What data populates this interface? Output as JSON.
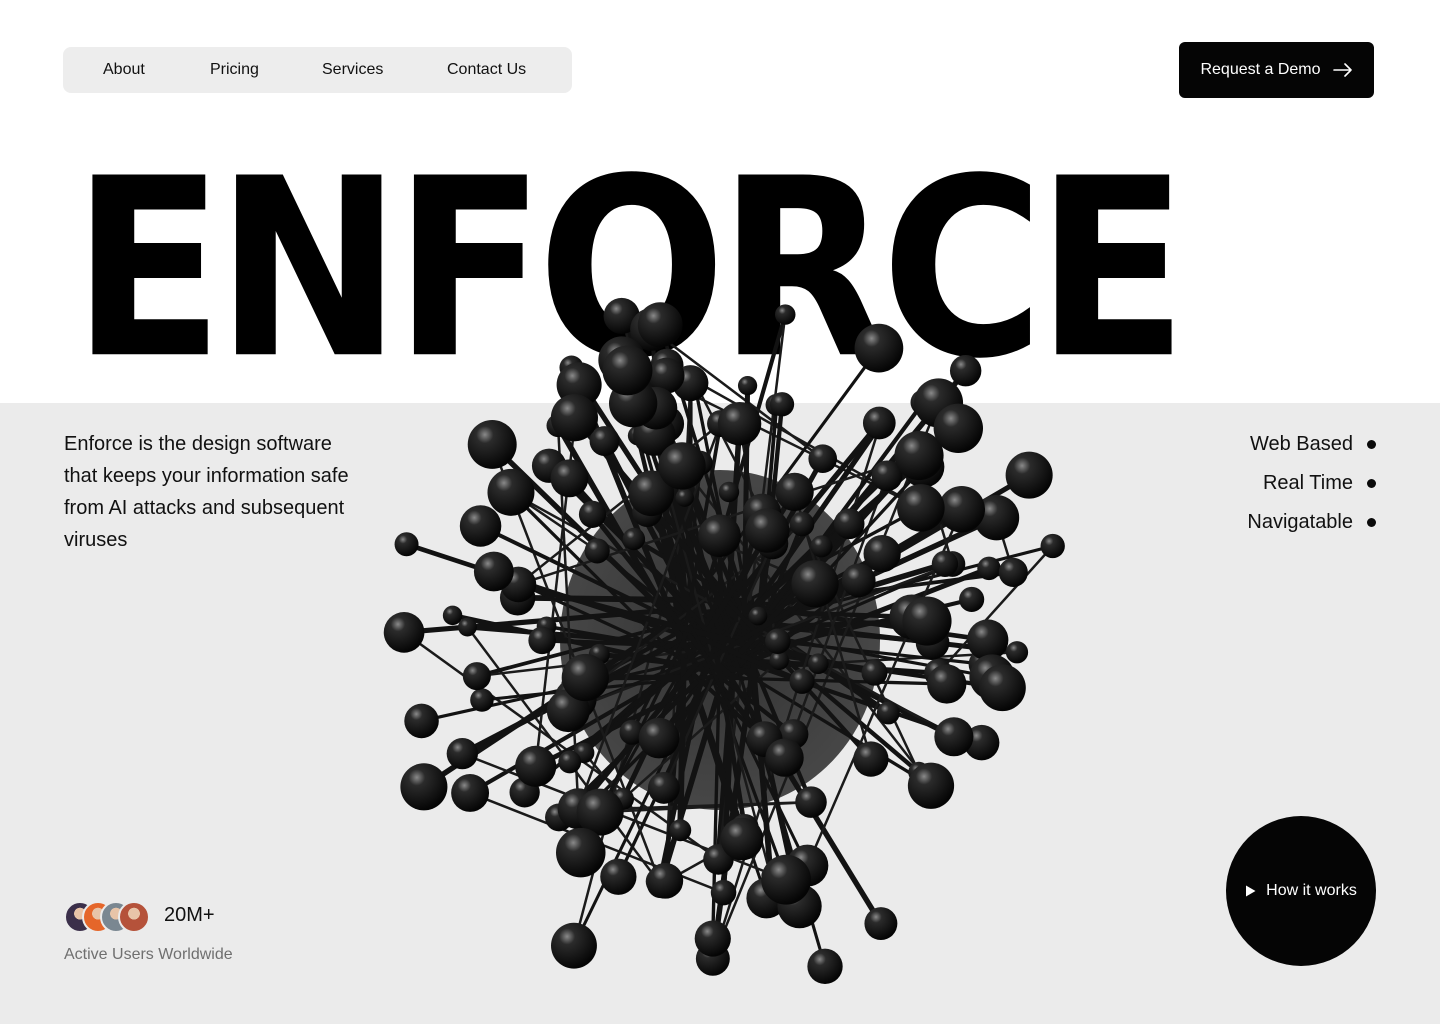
{
  "nav": {
    "items": [
      {
        "label": "About"
      },
      {
        "label": "Pricing"
      },
      {
        "label": "Services"
      },
      {
        "label": "Contact Us"
      }
    ]
  },
  "cta": {
    "demo_label": "Request a Demo",
    "demo_icon": "arrow-right-icon"
  },
  "hero": {
    "wordmark": "ENFORCE",
    "description": "Enforce is the design software that keeps your information safe from AI attacks and subsequent viruses",
    "image": "black-molecule-sphere-illustration"
  },
  "features": [
    {
      "label": "Web Based"
    },
    {
      "label": "Real Time"
    },
    {
      "label": "Navigatable"
    }
  ],
  "users": {
    "count": "20M+",
    "caption": "Active Users Worldwide",
    "avatar_colors": [
      "#3b2f4a",
      "#e5662a",
      "#7a8791",
      "#b5523a"
    ]
  },
  "how_it_works": {
    "label": "How it works",
    "icon": "play-icon"
  },
  "colors": {
    "background": "#ffffff",
    "panel": "#ebebeb",
    "accent": "#050505"
  }
}
